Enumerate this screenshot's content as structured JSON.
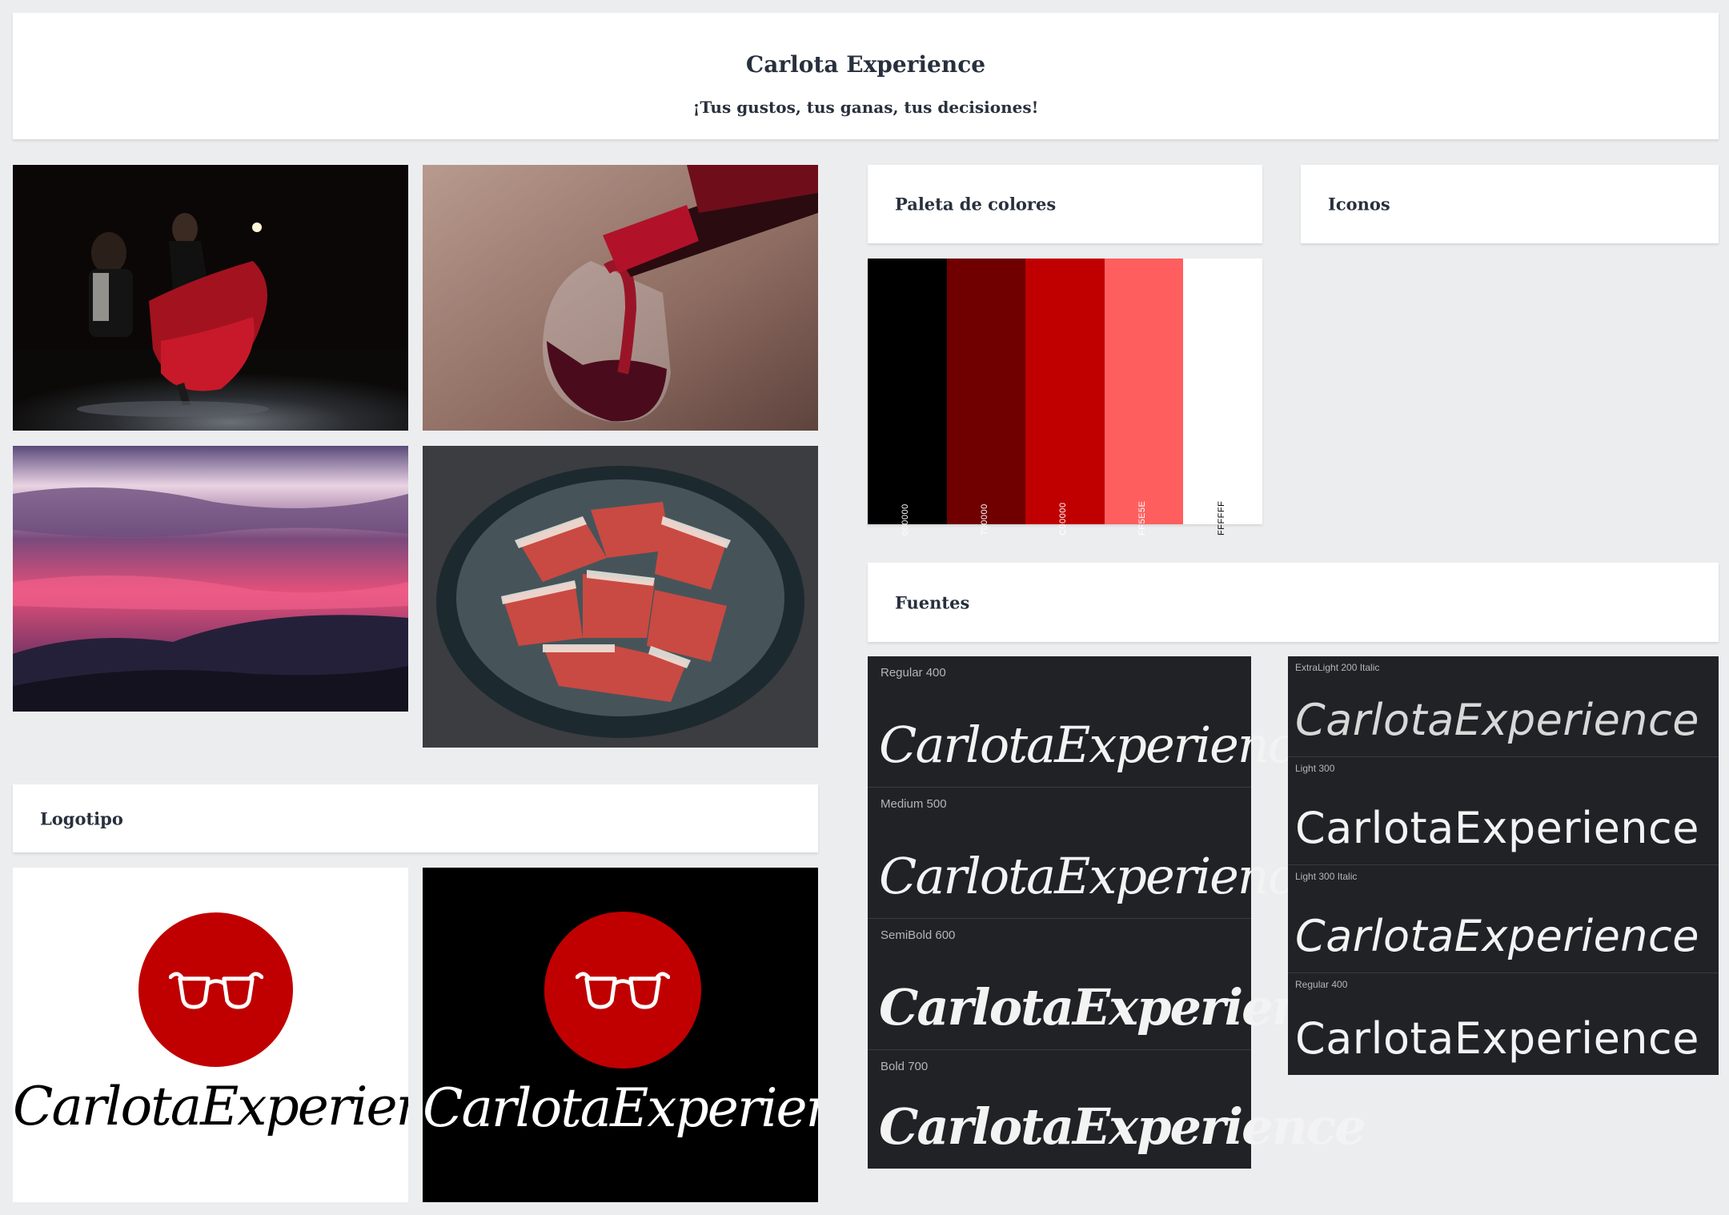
{
  "header": {
    "title": "Carlota Experience",
    "subtitle": "¡Tus gustos,  tus ganas, tus decisiones!"
  },
  "photos": [
    {
      "subject": "flamenco-dancer"
    },
    {
      "subject": "wine-pour"
    },
    {
      "subject": "purple-sunset"
    },
    {
      "subject": "jamon-plate"
    }
  ],
  "palette": {
    "title": "Paleta de colores",
    "colors": [
      {
        "hex": "#000000",
        "label": "000000",
        "text_color": "#ffffff"
      },
      {
        "hex": "#700000",
        "label": "700000",
        "text_color": "#ffffff"
      },
      {
        "hex": "#C00000",
        "label": "C00000",
        "text_color": "#ffffff"
      },
      {
        "hex": "#FF5E5E",
        "label": "FF5E5E",
        "text_color": "#ffffff"
      },
      {
        "hex": "#FFFFFF",
        "label": "FFFFFF",
        "text_color": "#000000"
      }
    ]
  },
  "icons": {
    "title": "Iconos"
  },
  "fonts": {
    "title": "Fuentes",
    "script": [
      {
        "weight": "Regular 400",
        "sample": "CarlotaExperience"
      },
      {
        "weight": "Medium 500",
        "sample": "CarlotaExperience"
      },
      {
        "weight": "SemiBold 600",
        "sample": "CarlotaExperience"
      },
      {
        "weight": "Bold 700",
        "sample": "CarlotaExperience"
      }
    ],
    "sans": [
      {
        "weight": "ExtraLight 200 Italic",
        "sample": "CarlotaExperience"
      },
      {
        "weight": "Light 300",
        "sample": "CarlotaExperience"
      },
      {
        "weight": "Light 300 Italic",
        "sample": "CarlotaExperience"
      },
      {
        "weight": "Regular 400",
        "sample": "CarlotaExperience"
      }
    ]
  },
  "logo": {
    "title": "Logotipo",
    "wordmark": "CarlotaExperience",
    "icon": "glasses-icon",
    "brand_color": "#c00000",
    "variants": [
      {
        "background": "#ffffff",
        "text_color": "#000000"
      },
      {
        "background": "#000000",
        "text_color": "#ffffff"
      }
    ]
  }
}
